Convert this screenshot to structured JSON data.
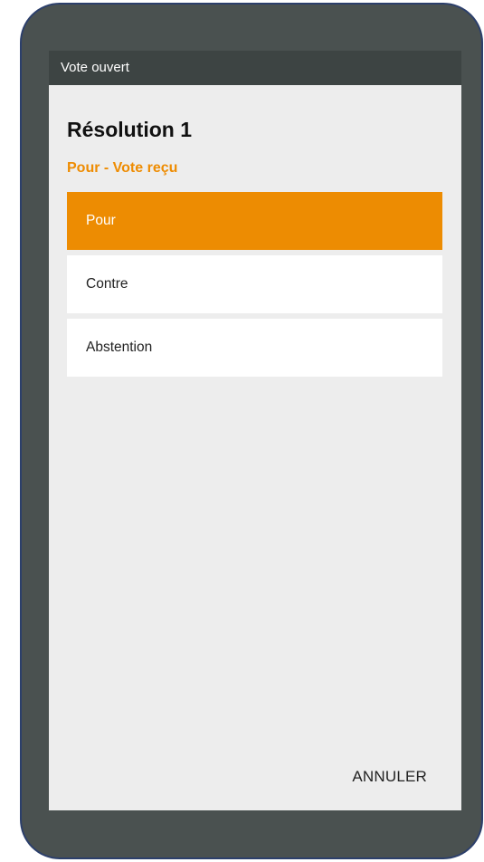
{
  "app_bar": {
    "title": "Vote ouvert"
  },
  "resolution": {
    "title": "Résolution 1",
    "status": "Pour - Vote reçu"
  },
  "options": [
    {
      "label": "Pour",
      "selected": true
    },
    {
      "label": "Contre",
      "selected": false
    },
    {
      "label": "Abstention",
      "selected": false
    }
  ],
  "actions": {
    "cancel_label": "ANNULER"
  },
  "colors": {
    "accent": "#ed8c02",
    "app_bar": "#3d4443",
    "screen_background": "#ededed",
    "device_frame": "#4a5150"
  }
}
